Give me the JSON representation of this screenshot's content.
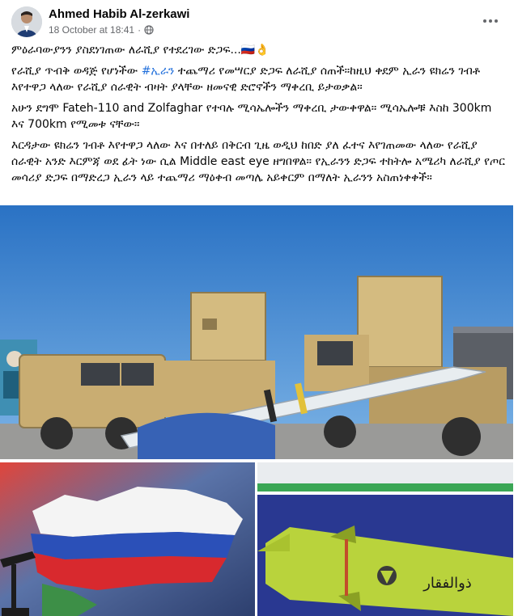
{
  "post": {
    "author": "Ahmed Habib Al-zerkawi",
    "timestamp": "18 October at 18:41",
    "separator": "·",
    "privacy_icon": "globe-icon",
    "more_icon": "more-options-icon",
    "paragraphs": [
      {
        "text": "ምዕራባውያንን ያስደነገጠው ለራሺያ የተደረገው ድጋፍ...🇷🇺👌"
      },
      {
        "pre": "የራሺያ ጥብቅ ወዳጅ የሆነችው ",
        "hashtag": "#ኢራን",
        "post": " ተጨማሪ የመሣርያ ድጋፍ ለራሺያ ሰጠች።ከዚህ ቀደም ኢራን ዩክሬን ገብቶ እየተዋጋ ላለው የራሺያ ሰራዊት ብዛት ያላቸው ዘመናዊ ድሮኖችን ማቀረቢ ይታወቃል።"
      },
      {
        "text": "አሁን ደግሞ Fateh-110 and Zolfaghar የተባሉ ሚሳኤሎችን ማቀረቢ ታውቀዋል። ሚሳኤሎቹ እስከ 300km እና 700km የሚመቱ ናቸው።"
      },
      {
        "text": "እርዳታው ዩክሬን ገብቶ እየተዋጋ ላለው እና በተለይ በቅርብ ጊዜ ወዲህ ከበድ ያለ ፈተና እየገጠመው ላለው የራሺያ ሰራዊት አንድ እርምጃ ወደ ፊት ነው ሲል Middle east eye ዘግበዋል። የኢራንን ድጋፍ ተከትሎ አሜሪካ ለራሺያ የጦር መሳሪያ ድጋፍ በማድረጋ ኢራን ላይ ተጨማሪ ማዕቀብ መጣሌ አይቀርም በማለት ኢራንን አስጠነቀቀች።"
      }
    ],
    "photos": {
      "main_alt": "missile-launcher-trucks-photo",
      "bottom_left_alt": "russia-map-flag-photo",
      "bottom_right_alt": "zolfaghar-missile-photo",
      "missile_inscription": "ذوالفقار"
    },
    "colors": {
      "hashtag": "#216fdb",
      "meta": "#65676b",
      "sky": "#2f7fd0",
      "truck": "#c9ad72",
      "missile_green": "#b9d33c"
    }
  }
}
